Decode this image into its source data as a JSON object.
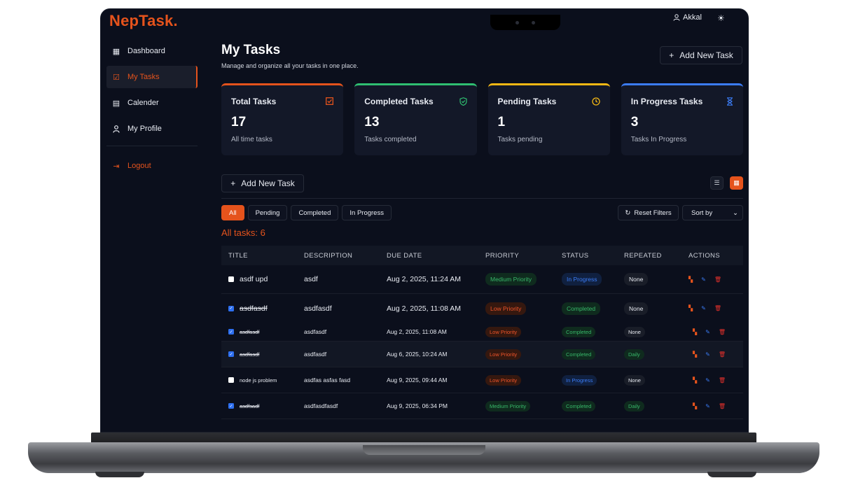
{
  "app": {
    "brand": "NepTask."
  },
  "topbar": {
    "user_name": "Akkal"
  },
  "sidebar": {
    "items": [
      {
        "label": "Dashboard"
      },
      {
        "label": "My Tasks"
      },
      {
        "label": "Calender"
      },
      {
        "label": "My Profile"
      }
    ],
    "logout_label": "Logout"
  },
  "header": {
    "title": "My Tasks",
    "subtitle": "Manage and organize all your tasks in one place.",
    "add_button_label": "Add New Task"
  },
  "stats": [
    {
      "title": "Total Tasks",
      "value": "17",
      "sub": "All time tasks",
      "color": "#e5531c",
      "icon": "checkbox-icon"
    },
    {
      "title": "Completed Tasks",
      "value": "13",
      "sub": "Tasks completed",
      "color": "#2fbf71",
      "icon": "shield-check-icon"
    },
    {
      "title": "Pending Tasks",
      "value": "1",
      "sub": "Tasks pending",
      "color": "#f5b814",
      "icon": "clock-icon"
    },
    {
      "title": "In Progress Tasks",
      "value": "3",
      "sub": "Tasks In Progress",
      "color": "#3b7cf6",
      "icon": "hourglass-icon"
    }
  ],
  "toolbar": {
    "add_button_label": "Add New Task"
  },
  "filters": {
    "chips": [
      "All",
      "Pending",
      "Completed",
      "In Progress"
    ],
    "reset_label": "Reset Filters",
    "sort_label": "Sort by"
  },
  "count_label": "All tasks: 6",
  "table": {
    "columns": [
      "TITLE",
      "DESCRIPTION",
      "DUE DATE",
      "PRIORITY",
      "STATUS",
      "REPEATED",
      "ACTIONS"
    ],
    "rows": [
      {
        "title": "asdf upd",
        "description": "asdf",
        "due": "Aug 2, 2025, 11:24 AM",
        "priority": "Medium Priority",
        "status": "In Progress",
        "repeated": "None",
        "done": false
      },
      {
        "title": "asdfasdf",
        "description": "asdfasdf",
        "due": "Aug 2, 2025, 11:08 AM",
        "priority": "Low Priority",
        "status": "Completed",
        "repeated": "None",
        "done": true
      },
      {
        "title": "asdfasdf",
        "description": "asdfasdf",
        "due": "Aug 2, 2025, 11:08 AM",
        "priority": "Low Priority",
        "status": "Completed",
        "repeated": "None",
        "done": true
      },
      {
        "title": "asdfasdf",
        "description": "asdfasdf",
        "due": "Aug 6, 2025, 10:24 AM",
        "priority": "Low Priority",
        "status": "Completed",
        "repeated": "Daily",
        "done": true
      },
      {
        "title": "node js problem",
        "description": "asdfas asfas fasd",
        "due": "Aug 9, 2025, 09:44 AM",
        "priority": "Low Priority",
        "status": "In Progress",
        "repeated": "None",
        "done": false
      },
      {
        "title": "asdfsadf",
        "description": "asdfasdfasdf",
        "due": "Aug 9, 2025, 06:34 PM",
        "priority": "Medium Priority",
        "status": "Completed",
        "repeated": "Daily",
        "done": true
      }
    ]
  },
  "colors": {
    "accent": "#e5531c",
    "background": "#0b0f1c",
    "card": "#131828"
  }
}
